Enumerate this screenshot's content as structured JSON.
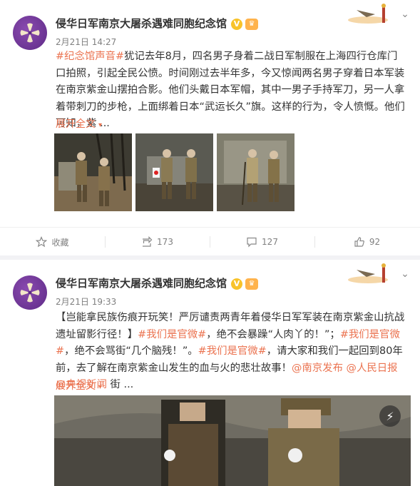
{
  "posts": [
    {
      "author": "侵华日军南京大屠杀遇难同胞纪念馆",
      "time": "2月21日 14:27",
      "text_parts": [
        {
          "type": "hash",
          "text": "#纪念馆声音#"
        },
        {
          "type": "plain",
          "text": "犹记去年8月，四名男子身着二战日军制服在上海四行仓库门口拍照，引起全民公愤。时间刚过去半年多，今又惊闻两名男子穿着日本军装在南京紫金山摆拍合影。他们头戴日本军帽，其中一男子手持军刀，另一人拿着带刺刀的步枪，上面绑着日本“武运长久”旗。这样的行为，令人愤慨。他们可知，紫 ..."
        }
      ],
      "expand_label": "展开全文",
      "photos": [
        "photo-1",
        "photo-2",
        "photo-3"
      ],
      "actions": {
        "favorite_label": "收藏",
        "repost_count": "173",
        "comment_count": "127",
        "like_count": "92"
      }
    },
    {
      "author": "侵华日军南京大屠杀遇难同胞纪念馆",
      "time": "2月21日 19:33",
      "text_parts": [
        {
          "type": "plain",
          "text": "【岂能拿民族伤痕开玩笑！严厉谴责两青年着侵华日军军装在南京紫金山抗战遗址留影行径！】"
        },
        {
          "type": "hash",
          "text": "#我们是官微#"
        },
        {
          "type": "plain",
          "text": "，绝不会暴躁“人肉丫的！”；"
        },
        {
          "type": "hash",
          "text": "#我们是官微#"
        },
        {
          "type": "plain",
          "text": "，绝不会骂街“几个脑残！”。"
        },
        {
          "type": "hash",
          "text": "#我们是官微#"
        },
        {
          "type": "plain",
          "text": "，请大家和我们一起回到80年前，去了解在南京紫金山发生的血与火的悲壮故事！"
        },
        {
          "type": "link",
          "text": "@南京发布"
        },
        {
          "type": "plain",
          "text": " "
        },
        {
          "type": "link",
          "text": "@人民日报"
        },
        {
          "type": "plain",
          "text": " "
        },
        {
          "type": "link",
          "text": "@央视新闻"
        },
        {
          "type": "plain",
          "text": " 街 ..."
        }
      ],
      "expand_label": "展开全文"
    }
  ],
  "colors": {
    "accent": "#eb7350",
    "meta": "#808080",
    "text": "#333333"
  },
  "icons": [
    "chevron-down-icon",
    "verified-badge-icon",
    "crown-icon",
    "star-icon",
    "repost-icon",
    "comment-icon",
    "like-icon",
    "lightning-icon"
  ]
}
